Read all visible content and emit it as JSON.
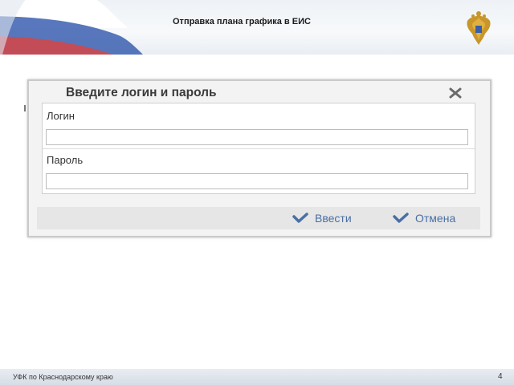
{
  "header": {
    "title": "Отправка плана графика в ЕИС",
    "emblem_icon": "coat-of-arms-icon"
  },
  "dialog": {
    "title": "Введите логин и пароль",
    "login_label": "Логин",
    "login_value": "",
    "password_label": "Пароль",
    "password_value": "",
    "submit_label": "Ввести",
    "cancel_label": "Отмена",
    "close_icon": "close-icon",
    "accent_color": "#4a6fa5"
  },
  "footer": {
    "organization": "УФК по Краснодарскому краю",
    "page_number": "4"
  }
}
